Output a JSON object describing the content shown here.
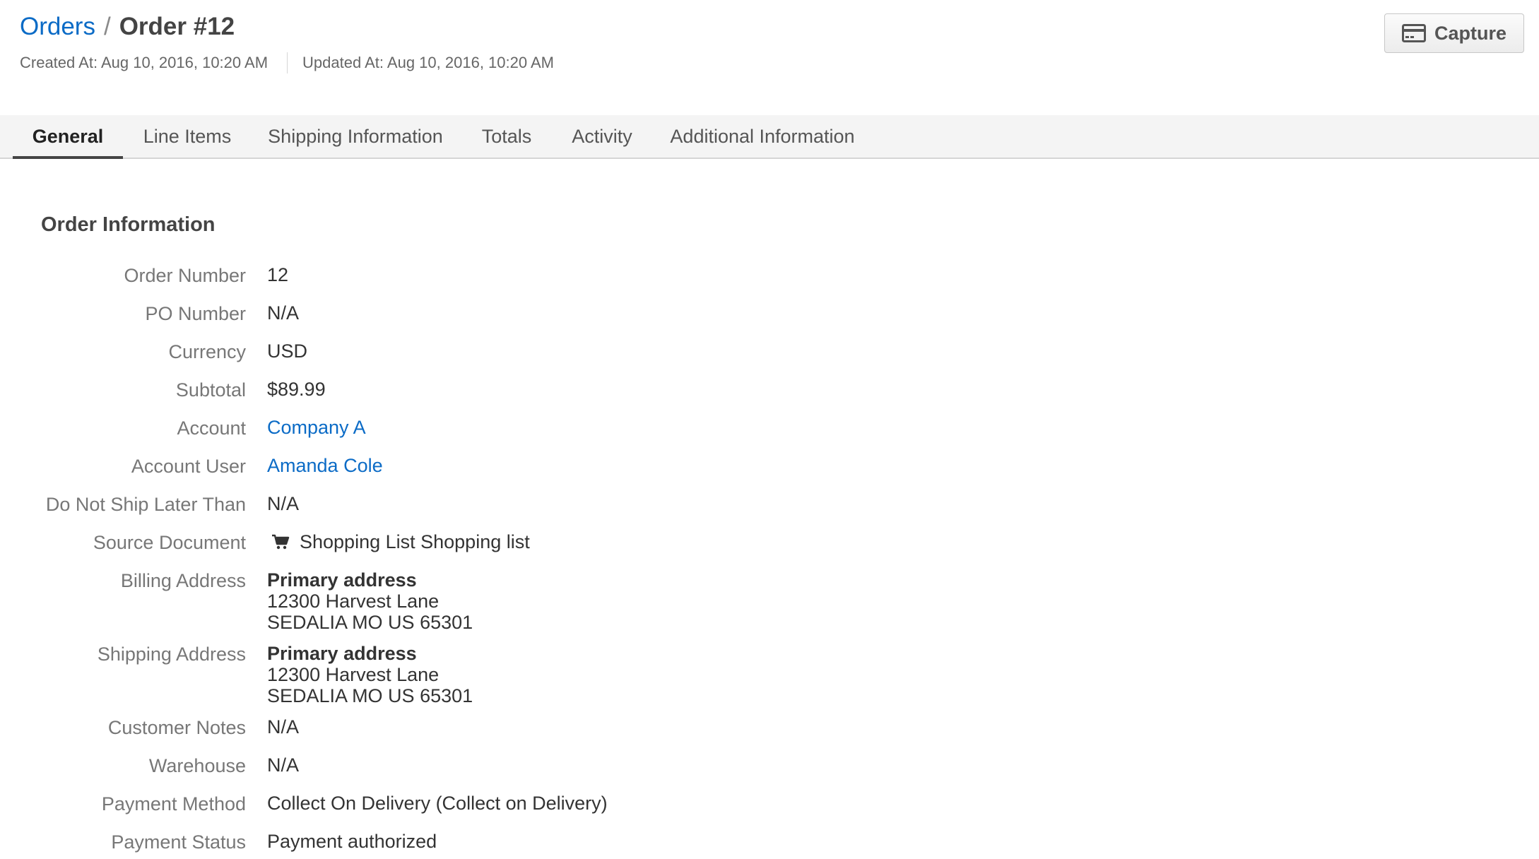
{
  "breadcrumb": {
    "parent": "Orders",
    "separator": "/",
    "current": "Order #12"
  },
  "meta": {
    "created": "Created At: Aug 10, 2016, 10:20 AM",
    "updated": "Updated At: Aug 10, 2016, 10:20 AM"
  },
  "actions": {
    "capture_label": "Capture",
    "capture_icon": "credit-card-icon"
  },
  "tabs": [
    {
      "label": "General",
      "active": true
    },
    {
      "label": "Line Items",
      "active": false
    },
    {
      "label": "Shipping Information",
      "active": false
    },
    {
      "label": "Totals",
      "active": false
    },
    {
      "label": "Activity",
      "active": false
    },
    {
      "label": "Additional Information",
      "active": false
    }
  ],
  "section": {
    "title": "Order Information"
  },
  "fields": {
    "order_number": {
      "label": "Order Number",
      "value": "12"
    },
    "po_number": {
      "label": "PO Number",
      "value": "N/A"
    },
    "currency": {
      "label": "Currency",
      "value": "USD"
    },
    "subtotal": {
      "label": "Subtotal",
      "value": "$89.99"
    },
    "account": {
      "label": "Account",
      "value": "Company A"
    },
    "account_user": {
      "label": "Account User",
      "value": "Amanda Cole"
    },
    "do_not_ship": {
      "label": "Do Not Ship Later Than",
      "value": "N/A"
    },
    "source_document": {
      "label": "Source Document",
      "value": "Shopping List Shopping list",
      "icon": "shopping-cart-icon"
    },
    "billing_address": {
      "label": "Billing Address",
      "name": "Primary address",
      "line1": "12300 Harvest Lane",
      "line2": "SEDALIA MO US 65301"
    },
    "shipping_address": {
      "label": "Shipping Address",
      "name": "Primary address",
      "line1": "12300 Harvest Lane",
      "line2": "SEDALIA MO US 65301"
    },
    "customer_notes": {
      "label": "Customer Notes",
      "value": "N/A"
    },
    "warehouse": {
      "label": "Warehouse",
      "value": "N/A"
    },
    "payment_method": {
      "label": "Payment Method",
      "value": "Collect On Delivery (Collect on Delivery)"
    },
    "payment_status": {
      "label": "Payment Status",
      "value": "Payment authorized"
    }
  },
  "colors": {
    "link": "#0b6bc6",
    "label": "#777777",
    "text": "#333333",
    "tab_bar": "#f4f4f4"
  }
}
